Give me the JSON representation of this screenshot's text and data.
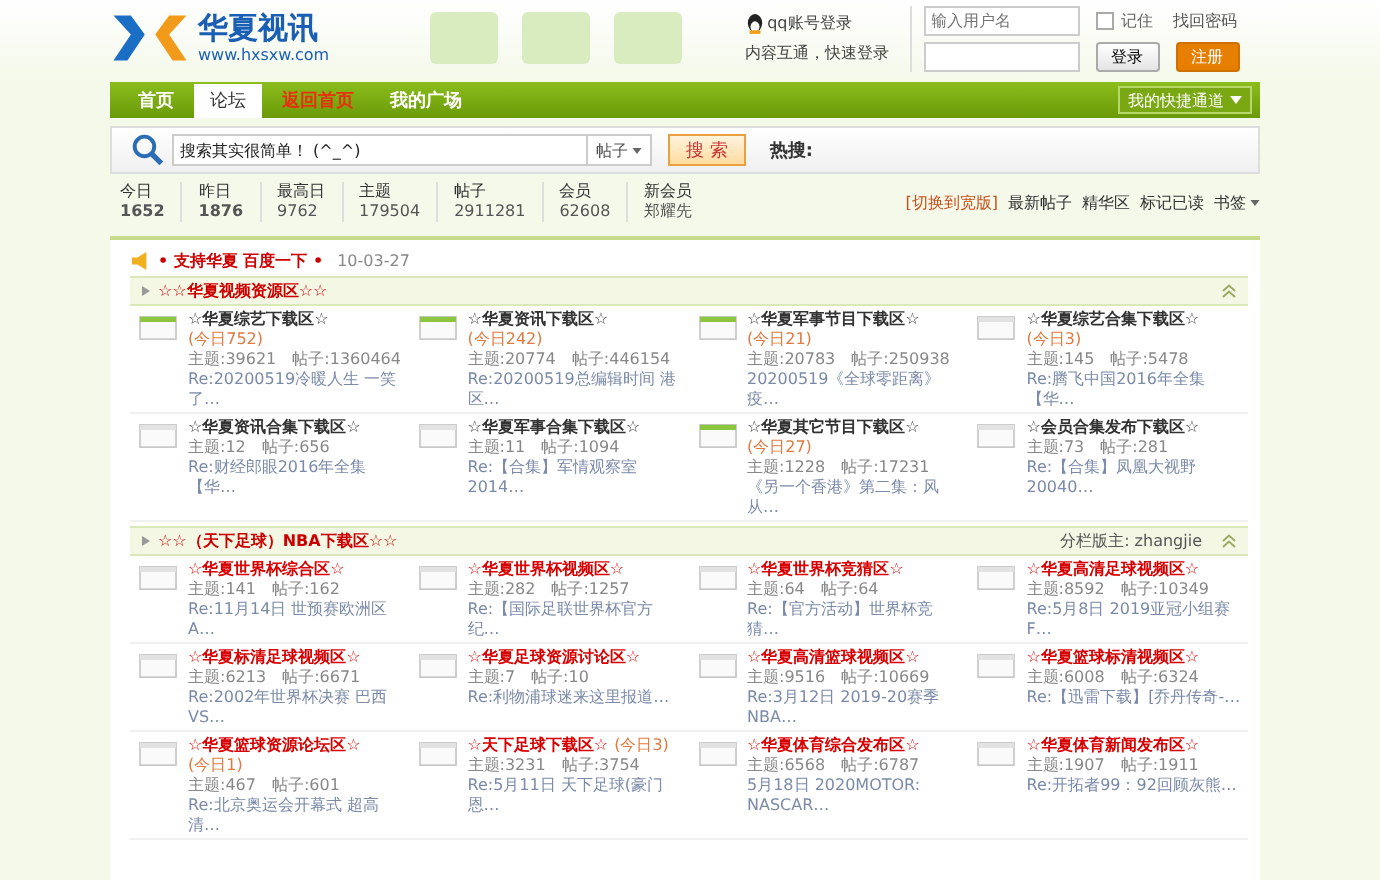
{
  "header": {
    "logo_text": "华夏视讯",
    "logo_url": "www.hxsxw.com",
    "qq_login": "qq账号登录",
    "qq_sub": "内容互通，快速登录",
    "username": {
      "placeholder": "输入用户名"
    },
    "remember": {
      "label": "记住",
      "checked": false
    },
    "forgot": "找回密码",
    "login": "登录",
    "register": "注册"
  },
  "nav": {
    "items": [
      {
        "label": "首页",
        "selected": false,
        "highlight": false
      },
      {
        "label": "论坛",
        "selected": true,
        "highlight": false
      },
      {
        "label": "返回首页",
        "selected": false,
        "highlight": true
      },
      {
        "label": "我的广场",
        "selected": false,
        "highlight": false
      }
    ],
    "quick": "我的快捷通道"
  },
  "search": {
    "value": "搜索其实很简单！ (^_^)",
    "scope": "帖子",
    "button": "搜 索",
    "hot": "热搜:"
  },
  "stats": [
    {
      "label": "今日",
      "value": "1652",
      "bold": true
    },
    {
      "label": "昨日",
      "value": "1876",
      "bold": true
    },
    {
      "label": "最高日",
      "value": "9762",
      "bold": false
    },
    {
      "label": "主题",
      "value": "179504",
      "bold": false
    },
    {
      "label": "帖子",
      "value": "2911281",
      "bold": false
    },
    {
      "label": "会员",
      "value": "62608",
      "bold": false
    },
    {
      "label": "新会员",
      "value": "郑耀先",
      "bold": false
    }
  ],
  "links": [
    {
      "label": "[切换到宽版]",
      "highlight": true,
      "dropdown": false
    },
    {
      "label": "最新帖子",
      "highlight": false,
      "dropdown": false
    },
    {
      "label": "精华区",
      "highlight": false,
      "dropdown": false
    },
    {
      "label": "标记已读",
      "highlight": false,
      "dropdown": false
    },
    {
      "label": "书签",
      "highlight": false,
      "dropdown": true
    }
  ],
  "notice": {
    "text": "• 支持华夏  百度一下 •",
    "date": "10-03-27"
  },
  "sections": [
    {
      "title": "☆☆华夏视频资源区☆☆",
      "red_titles": false,
      "forums": [
        {
          "title": "☆华夏综艺下载区☆",
          "today": "(今日752)",
          "topics": "主题:39621",
          "posts": "帖子:1360464",
          "last": "Re:20200519冷暖人生 一笑了…",
          "new": true
        },
        {
          "title": "☆华夏资讯下载区☆",
          "today": "(今日242)",
          "topics": "主题:20774",
          "posts": "帖子:446154",
          "last": "Re:20200519总编辑时间 港区…",
          "new": true
        },
        {
          "title": "☆华夏军事节目下载区☆",
          "today": "(今日21)",
          "topics": "主题:20783",
          "posts": "帖子:250938",
          "last": "20200519《全球零距离》疫…",
          "new": true
        },
        {
          "title": "☆华夏综艺合集下载区☆",
          "today": "(今日3)",
          "topics": "主题:145",
          "posts": "帖子:5478",
          "last": "Re:腾飞中国2016年全集【华…",
          "new": false
        },
        {
          "title": "☆华夏资讯合集下载区☆",
          "topics": "主题:12",
          "posts": "帖子:656",
          "last": "Re:财经郎眼2016年全集【华…",
          "new": false
        },
        {
          "title": "☆华夏军事合集下载区☆",
          "topics": "主题:11",
          "posts": "帖子:1094",
          "last": "Re:【合集】军情观察室2014…",
          "new": false
        },
        {
          "title": "☆华夏其它节目下载区☆",
          "today": "(今日27)",
          "topics": "主题:1228",
          "posts": "帖子:17231",
          "last": "《另一个香港》第二集：风从…",
          "new": true
        },
        {
          "title": "☆会员合集发布下载区☆",
          "topics": "主题:73",
          "posts": "帖子:281",
          "last": "Re:【合集】凤凰大视野20040…",
          "new": false
        }
      ]
    },
    {
      "title": "☆☆（天下足球）NBA下载区☆☆",
      "moderator": "分栏版主: zhangjie",
      "red_titles": true,
      "forums": [
        {
          "title": "☆华夏世界杯综合区☆",
          "topics": "主题:141",
          "posts": "帖子:162",
          "last": "Re:11月14日 世预赛欧洲区A…",
          "new": false
        },
        {
          "title": "☆华夏世界杯视频区☆",
          "topics": "主题:282",
          "posts": "帖子:1257",
          "last": "Re:【国际足联世界杯官方纪…",
          "new": false
        },
        {
          "title": "☆华夏世界杯竞猜区☆",
          "topics": "主题:64",
          "posts": "帖子:64",
          "last": "Re:【官方活动】世界杯竞猜…",
          "new": false
        },
        {
          "title": "☆华夏高清足球视频区☆",
          "topics": "主题:8592",
          "posts": "帖子:10349",
          "last": "Re:5月8日 2019亚冠小组赛F…",
          "new": false
        },
        {
          "title": "☆华夏标清足球视频区☆",
          "topics": "主题:6213",
          "posts": "帖子:6671",
          "last": "Re:2002年世界杯决赛 巴西VS…",
          "new": false
        },
        {
          "title": "☆华夏足球资源讨论区☆",
          "topics": "主题:7",
          "posts": "帖子:10",
          "last": "Re:利物浦球迷来这里报道…",
          "new": false
        },
        {
          "title": "☆华夏高清篮球视频区☆",
          "topics": "主题:9516",
          "posts": "帖子:10669",
          "last": "Re:3月12日 2019-20赛季NBA…",
          "new": false
        },
        {
          "title": "☆华夏篮球标清视频区☆",
          "topics": "主题:6008",
          "posts": "帖子:6324",
          "last": "Re:【迅雷下载】[乔丹传奇-…",
          "new": false
        },
        {
          "title": "☆华夏篮球资源论坛区☆",
          "today": "(今日1)",
          "topics": "主题:467",
          "posts": "帖子:601",
          "last": "Re:北京奥运会开幕式 超高清…",
          "new": false
        },
        {
          "title": "☆天下足球下载区☆",
          "today": "(今日3)",
          "topics": "主题:3231",
          "posts": "帖子:3754",
          "last": "Re:5月11日 天下足球(豪门恩…",
          "new": false
        },
        {
          "title": "☆华夏体育综合发布区☆",
          "topics": "主题:6568",
          "posts": "帖子:6787",
          "last": "5月18日 2020MOTOR: NASCAR…",
          "new": false
        },
        {
          "title": "☆华夏体育新闻发布区☆",
          "topics": "主题:1907",
          "posts": "帖子:1911",
          "last": "Re:开拓者99：92回顾灰熊…",
          "new": false
        }
      ]
    }
  ]
}
